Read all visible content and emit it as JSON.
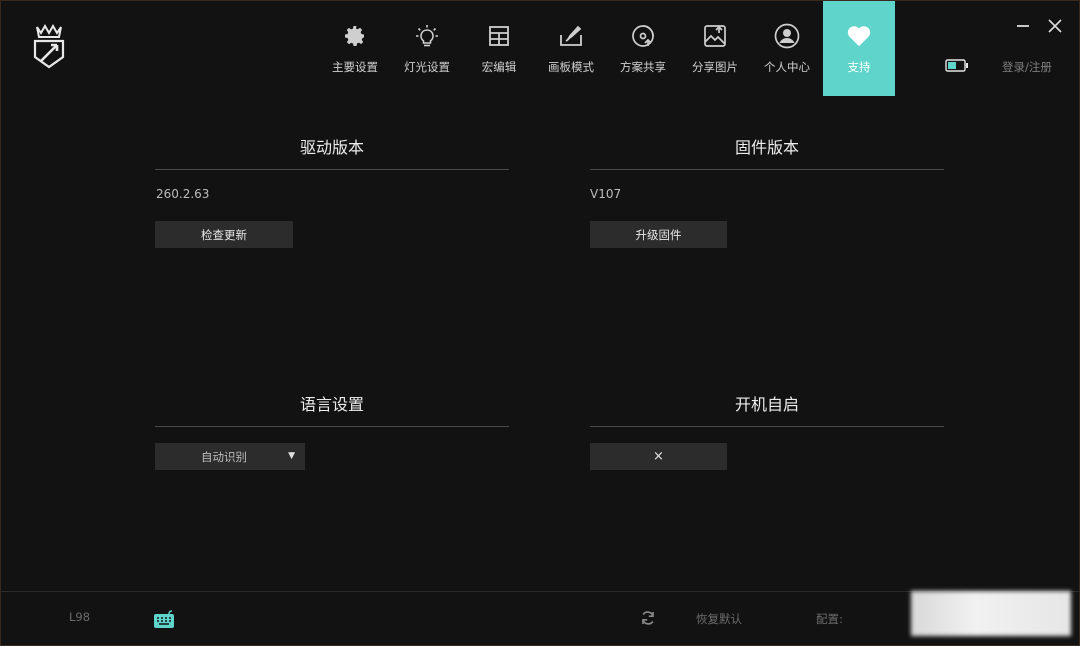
{
  "nav": {
    "items": [
      {
        "label": "主要设置",
        "icon": "gear-icon"
      },
      {
        "label": "灯光设置",
        "icon": "lightbulb-icon"
      },
      {
        "label": "宏编辑",
        "icon": "macro-grid-icon"
      },
      {
        "label": "画板模式",
        "icon": "paint-board-icon"
      },
      {
        "label": "方案共享",
        "icon": "share-disc-icon"
      },
      {
        "label": "分享图片",
        "icon": "share-image-icon"
      },
      {
        "label": "个人中心",
        "icon": "user-icon"
      },
      {
        "label": "支持",
        "icon": "heart-icon"
      }
    ],
    "active_index": 7,
    "accent": "#5fd4cb"
  },
  "header": {
    "login_label": "登录/注册"
  },
  "driver": {
    "title": "驱动版本",
    "version": "260.2.63",
    "button_label": "检查更新"
  },
  "firmware": {
    "title": "固件版本",
    "version": "V107",
    "button_label": "升级固件"
  },
  "language": {
    "title": "语言设置",
    "selected": "自动识别"
  },
  "autostart": {
    "title": "开机自启",
    "value": "×"
  },
  "footer": {
    "device_name": "L98",
    "restore_label": "恢复默认",
    "config_label": "配置:"
  }
}
